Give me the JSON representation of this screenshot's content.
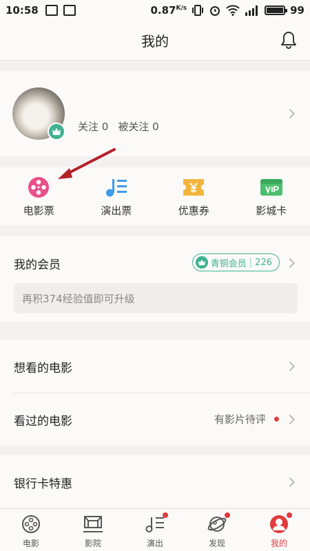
{
  "status_bar": {
    "time": "10:58",
    "speed": "0.87",
    "speed_unit": "K/s",
    "battery": "99",
    "battery_level": 0.99
  },
  "header": {
    "title": "我的"
  },
  "profile": {
    "following_label": "关注",
    "following_count": "0",
    "followers_label": "被关注",
    "followers_count": "0"
  },
  "quick_links": [
    {
      "label": "电影票",
      "icon": "film-reel-icon"
    },
    {
      "label": "演出票",
      "icon": "music-note-icon"
    },
    {
      "label": "优惠券",
      "icon": "coupon-icon"
    },
    {
      "label": "影城卡",
      "icon": "vip-card-icon"
    }
  ],
  "member": {
    "title": "我的会员",
    "badge_level": "青铜会员",
    "badge_points": "226",
    "upgrade_tip": "再积374经验值即可升级"
  },
  "movies": {
    "want_to_watch": "想看的电影",
    "watched": "看过的电影",
    "pending_review": "有影片待评"
  },
  "bank": {
    "label": "银行卡特惠"
  },
  "tabs": [
    {
      "label": "电影",
      "icon": "film-reel-icon",
      "active": false,
      "dot": false
    },
    {
      "label": "影院",
      "icon": "cinema-screen-icon",
      "active": false,
      "dot": false
    },
    {
      "label": "演出",
      "icon": "music-note-icon",
      "active": false,
      "dot": true
    },
    {
      "label": "发现",
      "icon": "planet-icon",
      "active": false,
      "dot": true
    },
    {
      "label": "我的",
      "icon": "user-icon",
      "active": true,
      "dot": true
    }
  ],
  "colors": {
    "accent_red": "#e23b3b",
    "member_green": "#3fb28e",
    "ticket_pink": "#e9508a",
    "music_blue": "#3b9be8",
    "coupon_yellow": "#f4b43c",
    "vip_green": "#4cbf6e"
  }
}
